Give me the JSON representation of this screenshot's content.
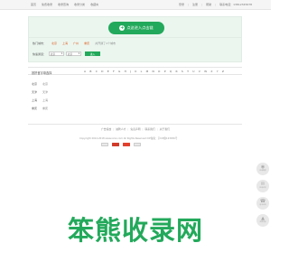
{
  "topbar": {
    "left": [
      "首页",
      "免费收录",
      "收录查询",
      "收录分类",
      "收藏夹"
    ],
    "right": [
      "登录",
      "注册",
      "帮助",
      "联系电话：13812345678"
    ]
  },
  "hero": {
    "button_label": "点这进入点击链",
    "icon": "plus-icon"
  },
  "panel": {
    "hot_label": "热门城市：",
    "hot_cities": [
      "北京",
      "上海",
      "广州",
      "重庆"
    ],
    "hot_note": "共开通了1个城市",
    "quick_label": "快速通道：",
    "select1": "北京",
    "select2": "北京",
    "go_label": "进入"
  },
  "letters": {
    "title": "按拼音字母选择",
    "items": [
      "A",
      "B",
      "C",
      "D",
      "E",
      "F",
      "G",
      "H",
      "J",
      "K",
      "L",
      "M",
      "N",
      "O",
      "P",
      "Q",
      "R",
      "S",
      "T",
      "U",
      "V",
      "W",
      "X",
      "Y",
      "Z"
    ]
  },
  "cities": [
    {
      "prov": "北京",
      "city": "北京"
    },
    {
      "prov": "天津",
      "city": "天津"
    },
    {
      "prov": "上海",
      "city": "上海"
    },
    {
      "prov": "重庆",
      "city": "重庆"
    }
  ],
  "footer": {
    "links": [
      "广告投放",
      "诚聘人才",
      "免责声明",
      "联系我们",
      "关于我们"
    ],
    "copyright": "Copyright 2012-2018 www.xxxx.com All Rights Reserved ICP备案：京ICP备123456号"
  },
  "watermark": "笨熊收录网",
  "floats": [
    {
      "icon": "qq-icon",
      "glyph": "◉",
      "caption": "在线客服"
    },
    {
      "icon": "chat-icon",
      "glyph": "✉",
      "caption": "在线咨询"
    },
    {
      "icon": "phone-icon",
      "glyph": "☎",
      "caption": "电话咨询"
    },
    {
      "icon": "top-icon",
      "glyph": "▲",
      "caption": "返回顶部"
    }
  ],
  "colors": {
    "accent": "#23a95b",
    "link": "#e05a1d"
  }
}
